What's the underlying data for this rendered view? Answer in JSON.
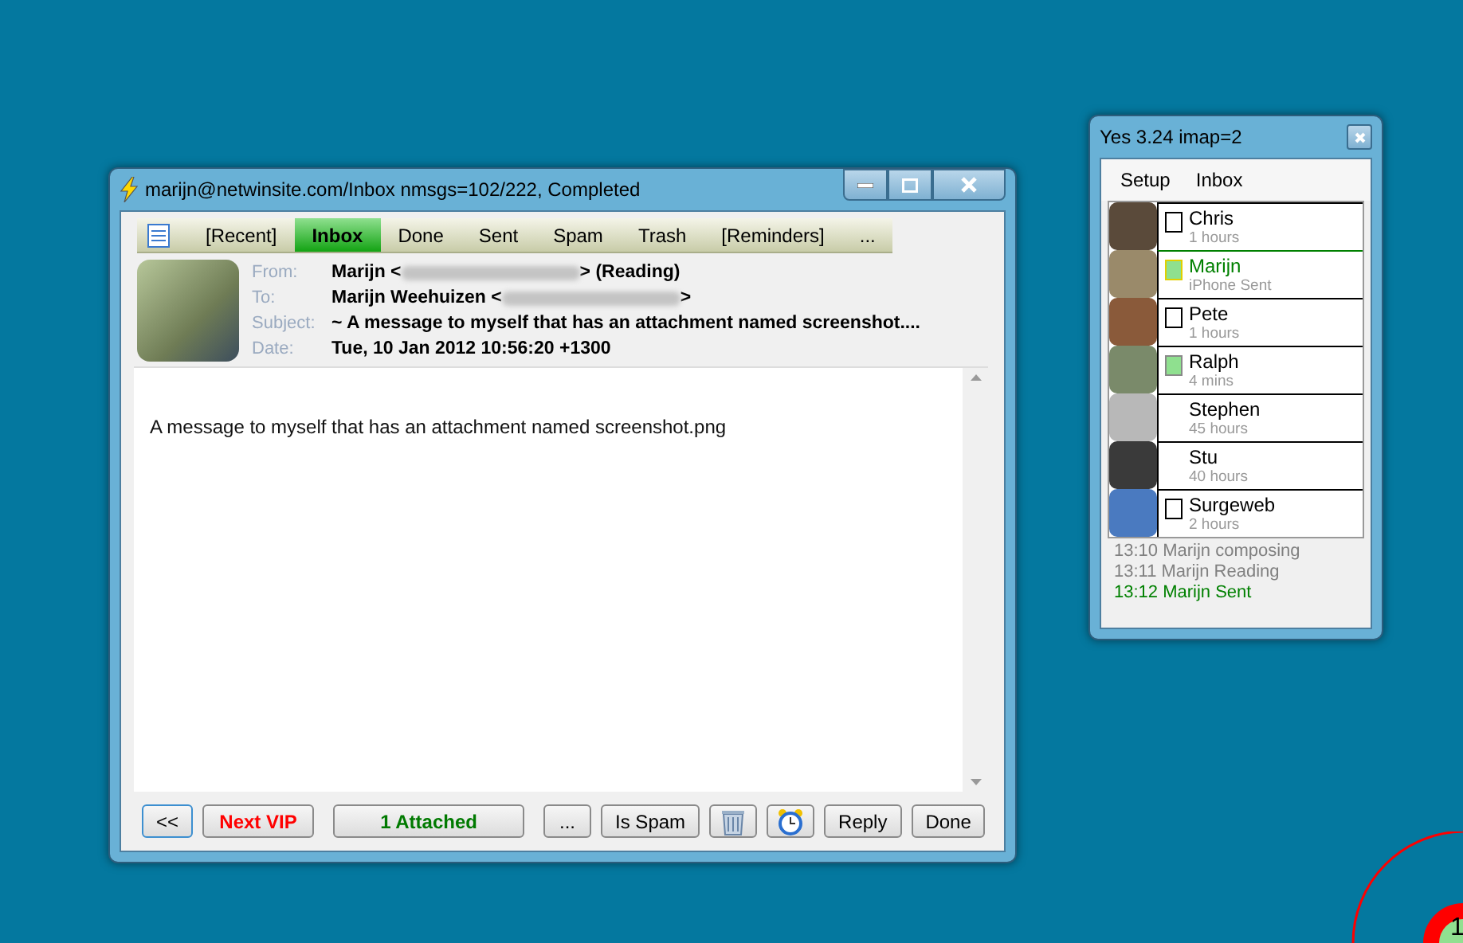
{
  "mail_window": {
    "title": "marijn@netwinsite.com/Inbox nmsgs=102/222,  Completed",
    "tabs": [
      {
        "label": "[Recent]",
        "selected": false
      },
      {
        "label": "Inbox",
        "selected": true
      },
      {
        "label": "Done",
        "selected": false
      },
      {
        "label": "Sent",
        "selected": false
      },
      {
        "label": "Spam",
        "selected": false
      },
      {
        "label": "Trash",
        "selected": false
      },
      {
        "label": "[Reminders]",
        "selected": false
      },
      {
        "label": "...",
        "selected": false
      }
    ],
    "header": [
      {
        "label": "From:",
        "before": "Marijn <",
        "after": "> (Reading)",
        "redacted": true
      },
      {
        "label": "To:",
        "before": " Marijn Weehuizen <",
        "after": ">",
        "redacted": true
      },
      {
        "label": "Subject:",
        "before": "~ A message to myself that has an attachment named screenshot...."
      },
      {
        "label": "Date:",
        "before": "Tue, 10 Jan 2012 10:56:20 +1300"
      }
    ],
    "body": "A message to myself that has an attachment named screenshot.png",
    "nav_buttons": [
      {
        "label": "<<",
        "focused": true
      },
      {
        "label": "Next VIP",
        "color": "#ff0000",
        "focused": false
      }
    ],
    "attachment_button": {
      "label": "1 Attached",
      "color": "#007a00"
    },
    "action_buttons": [
      {
        "kind": "text",
        "label": "..."
      },
      {
        "kind": "text",
        "label": "Is Spam"
      },
      {
        "kind": "trash"
      },
      {
        "kind": "alarm"
      },
      {
        "kind": "text",
        "label": "Reply"
      },
      {
        "kind": "text",
        "label": "Done"
      }
    ]
  },
  "yes_window": {
    "title": "Yes 3.24 imap=2",
    "menu": [
      "Setup",
      "Inbox"
    ],
    "contacts": [
      {
        "name": "Chris",
        "status": "1 hours",
        "kind": "boxed",
        "checked": false,
        "selected": false
      },
      {
        "name": "Marijn",
        "status": "iPhone Sent",
        "kind": "boxed",
        "checked": true,
        "selected": true
      },
      {
        "name": "Pete",
        "status": "1 hours",
        "kind": "boxed",
        "checked": false,
        "selected": false
      },
      {
        "name": "Ralph",
        "status": "4 mins",
        "kind": "boxed",
        "checked": true,
        "selected": false
      },
      {
        "name": "Stephen",
        "status": "45 hours",
        "kind": "plain",
        "selected": false
      },
      {
        "name": "Stu",
        "status": "40 hours",
        "kind": "plain",
        "selected": false
      },
      {
        "name": "Surgeweb",
        "status": "2 hours",
        "kind": "boxed",
        "checked": false,
        "selected": false
      }
    ],
    "log": [
      {
        "text": "13:10 Marijn composing",
        "color": "#808080"
      },
      {
        "text": "13:11 Marijn Reading",
        "color": "#808080"
      },
      {
        "text": "13:12 Marijn Sent",
        "color": "#008000"
      }
    ]
  },
  "corner_badge": "1"
}
